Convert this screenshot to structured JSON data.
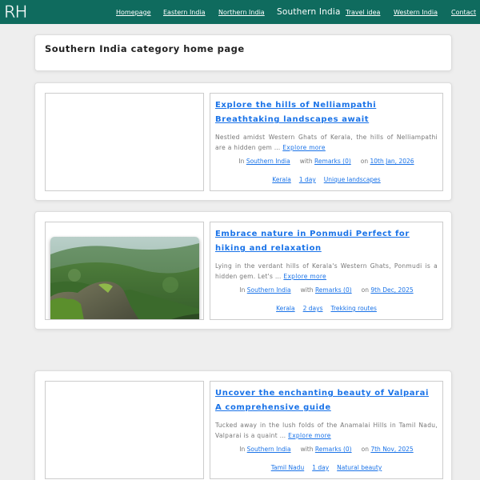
{
  "header": {
    "logo": "RH",
    "nav": [
      {
        "label": "Homepage",
        "active": false
      },
      {
        "label": "Eastern India",
        "active": false
      },
      {
        "label": "Northern India",
        "active": false
      },
      {
        "label": "Southern India",
        "active": true
      },
      {
        "label": "Travel idea",
        "active": false
      },
      {
        "label": "Western India",
        "active": false
      },
      {
        "label": "Contact",
        "active": false
      }
    ]
  },
  "page": {
    "title": "Southern India category home page"
  },
  "posts": [
    {
      "title": "Explore the hills of Nelliampathi Breathtaking landscapes await",
      "excerpt": "Nestled amidst Western Ghats of Kerala, the hills of Nelliampathi are a hidden gem …",
      "more": "Explore more",
      "in_label": "In",
      "category": "Southern India",
      "with_label": "with",
      "remarks": "Remarks (0)",
      "on_label": "on",
      "date": "10th Jan, 2026",
      "tags": [
        "Kerala",
        "1 day",
        "Unique landscapes"
      ],
      "has_image": false
    },
    {
      "title": "Embrace nature in Ponmudi Perfect for hiking and relaxation",
      "excerpt": "Lying in the verdant hills of Kerala's Western Ghats, Ponmudi is a hidden gem. Let's …",
      "more": "Explore more",
      "in_label": "In",
      "category": "Southern India",
      "with_label": "with",
      "remarks": "Remarks (0)",
      "on_label": "on",
      "date": "9th Dec, 2025",
      "tags": [
        "Kerala",
        "2 days",
        "Trekking routes"
      ],
      "has_image": true
    },
    {
      "title": "Uncover the enchanting beauty of Valparai A comprehensive guide",
      "excerpt": "Tucked away in the lush folds of the Anamalai Hills in Tamil Nadu, Valparai is a quaint …",
      "more": "Explore more",
      "in_label": "In",
      "category": "Southern India",
      "with_label": "with",
      "remarks": "Remarks (0)",
      "on_label": "on",
      "date": "7th Nov, 2025",
      "tags": [
        "Tamil Nadu",
        "1 day",
        "Natural beauty"
      ],
      "has_image": false
    }
  ],
  "colors": {
    "header_bg": "#0f6b5e",
    "link": "#1a73e8",
    "page_bg": "#eeeeee"
  }
}
